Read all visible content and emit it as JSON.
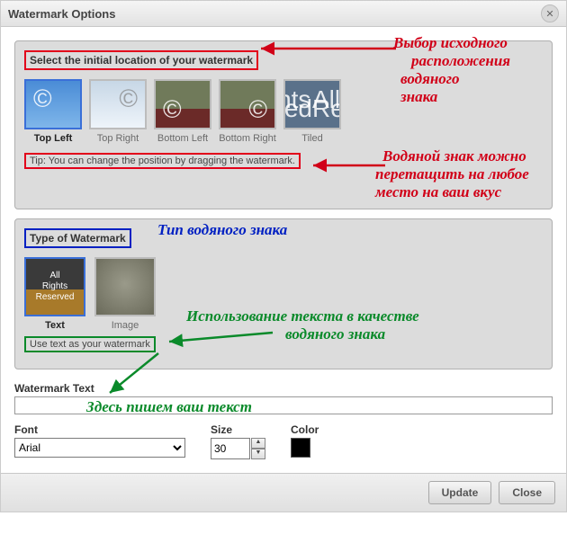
{
  "dialog": {
    "title": "Watermark Options"
  },
  "location": {
    "heading": "Select the initial location of your watermark",
    "options": [
      {
        "label": "Top Left",
        "selected": true
      },
      {
        "label": "Top Right",
        "selected": false
      },
      {
        "label": "Bottom Left",
        "selected": false
      },
      {
        "label": "Bottom Right",
        "selected": false
      },
      {
        "label": "Tiled",
        "selected": false
      }
    ],
    "tiled_preview_text": "All Rights Reserved",
    "tip": "Tip: You can change the position by dragging the watermark."
  },
  "type": {
    "heading": "Type of Watermark",
    "options": [
      {
        "label": "Text",
        "selected": true
      },
      {
        "label": "Image",
        "selected": false
      }
    ],
    "text_preview": "All\nRights\nReserved",
    "tip": "Use text as your watermark"
  },
  "watermark_text": {
    "label": "Watermark Text",
    "value": ""
  },
  "font": {
    "label": "Font",
    "value": "Arial"
  },
  "size": {
    "label": "Size",
    "value": "30"
  },
  "color": {
    "label": "Color",
    "value": "#000000"
  },
  "buttons": {
    "update": "Update",
    "close": "Close"
  },
  "annotations": {
    "loc1": "Выбор исходного",
    "loc2": "расположения",
    "loc3": "водяного",
    "loc4": "знака",
    "tip1": "Водяной знак можно",
    "tip2": "перетащить на любое",
    "tip3": "место на ваш вкус",
    "type": "Тип водяного знака",
    "use1": "Использование текста в качестве",
    "use2": "водяного знака",
    "here": "Здесь пишем ваш текст"
  }
}
